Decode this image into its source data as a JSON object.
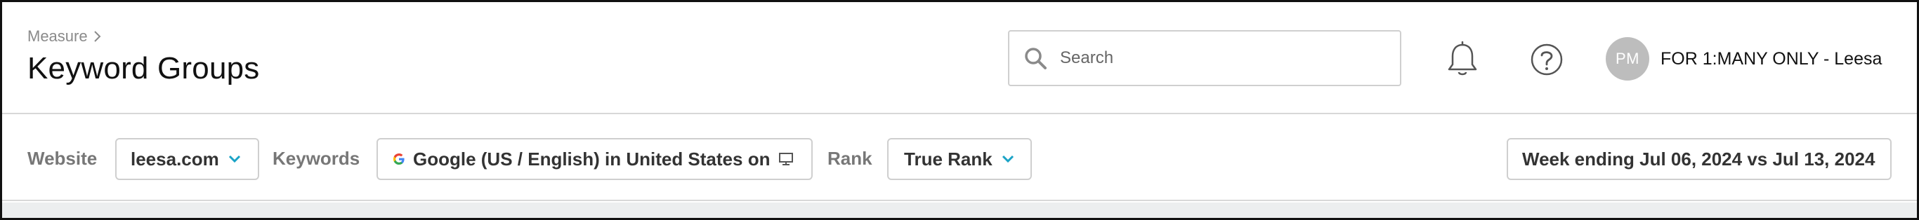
{
  "header": {
    "breadcrumb": "Measure",
    "title": "Keyword Groups",
    "search": {
      "placeholder": "Search",
      "value": ""
    },
    "user": {
      "initials": "PM",
      "name": "FOR 1:MANY ONLY - Leesa"
    }
  },
  "filters": {
    "website_label": "Website",
    "website_value": "leesa.com",
    "keywords_label": "Keywords",
    "keywords_value": "Google (US / English) in United States on",
    "rank_label": "Rank",
    "rank_value": "True Rank",
    "date_range": "Week ending Jul 06, 2024 vs Jul 13, 2024"
  },
  "colors": {
    "accent": "#1aa3c6",
    "avatar_bg": "#bdbdbd",
    "border": "#cfcfcf",
    "label_gray": "#777777",
    "strip_bg": "#eceeef"
  },
  "icons": {
    "search": "search-icon",
    "notifications": "bell-icon",
    "help": "help-icon",
    "breadcrumb_chevron": "chevron-right-icon",
    "dropdown": "chevron-down-icon",
    "engine": "google-icon",
    "device": "desktop-icon"
  }
}
